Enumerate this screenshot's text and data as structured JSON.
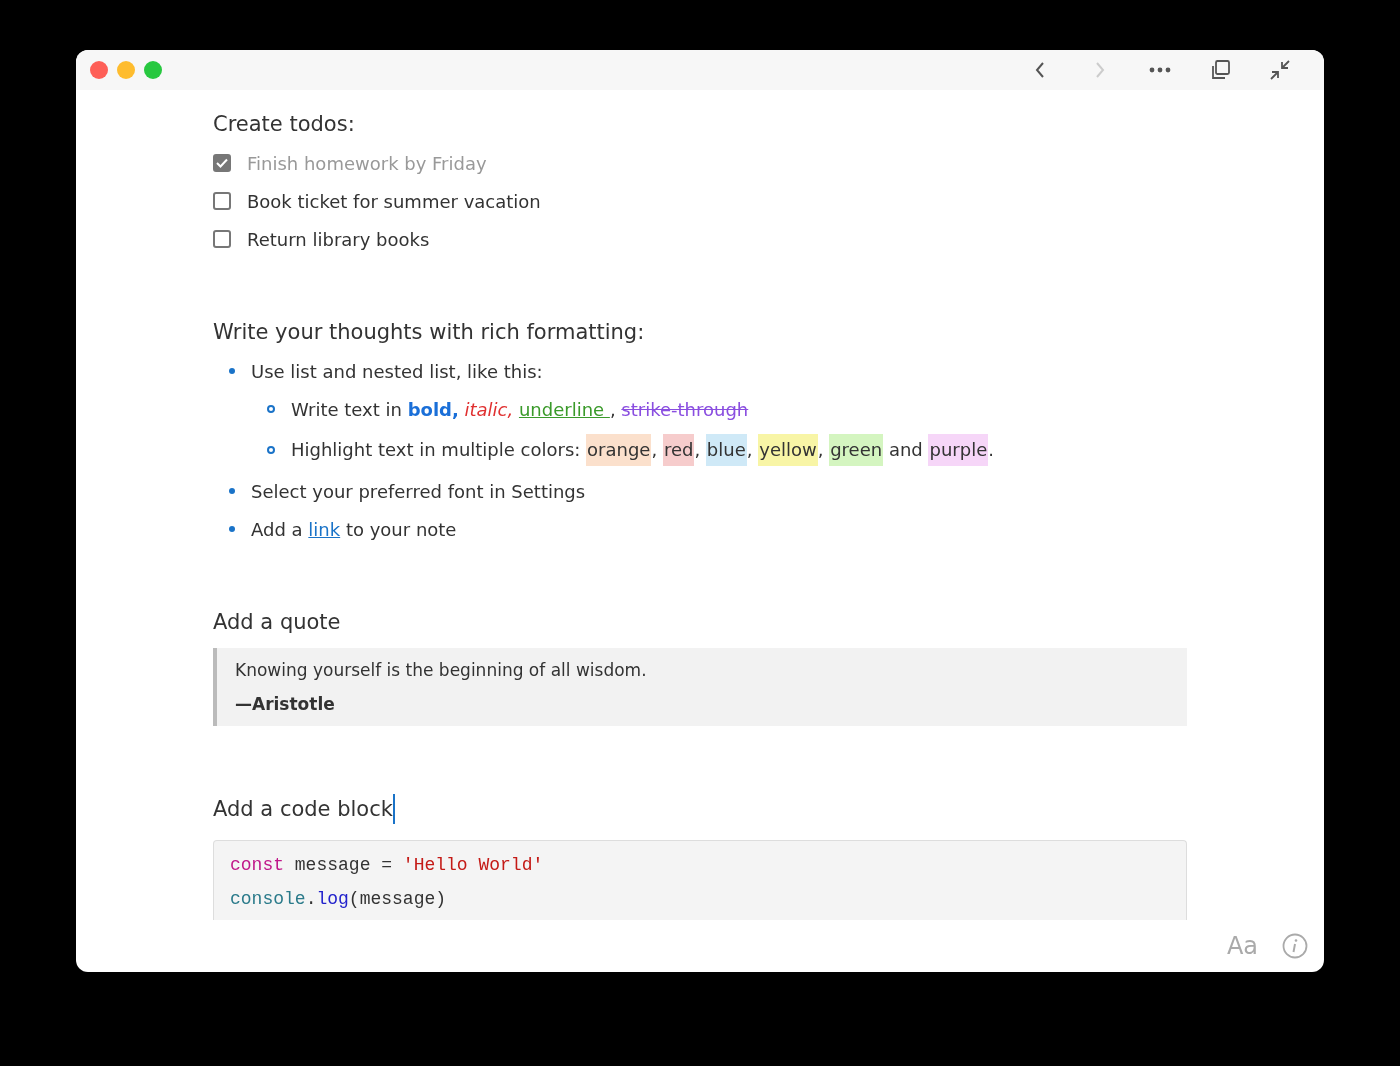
{
  "toolbar": {
    "back": {
      "disabled": false
    },
    "forward": {
      "disabled": true
    }
  },
  "sections": [
    {
      "kind": "todos",
      "heading": "Create todos:",
      "items": [
        {
          "text": "Finish homework by Friday",
          "checked": true
        },
        {
          "text": "Book ticket for summer vacation",
          "checked": false
        },
        {
          "text": "Return library books",
          "checked": false
        }
      ]
    },
    {
      "kind": "list",
      "heading": "Write your thoughts with rich formatting:",
      "items": [
        {
          "segments": [
            {
              "kind": "plain",
              "text": "Use list and nested list, like this:"
            }
          ],
          "children": [
            {
              "segments": [
                {
                  "kind": "plain",
                  "text": "Write text in "
                },
                {
                  "kind": "bold",
                  "text": "bold,"
                },
                {
                  "kind": "italic",
                  "text": " italic, "
                },
                {
                  "kind": "underline",
                  "text": "underline "
                },
                {
                  "kind": "plain",
                  "text": ", "
                },
                {
                  "kind": "strike",
                  "text": "strike-through"
                }
              ]
            },
            {
              "segments": [
                {
                  "kind": "plain",
                  "text": "Highlight text in multiple colors: "
                },
                {
                  "kind": "highlight",
                  "text": "orange",
                  "color": "#fbe0cc"
                },
                {
                  "kind": "plain",
                  "text": ", "
                },
                {
                  "kind": "highlight",
                  "text": "red",
                  "color": "#f6cccc"
                },
                {
                  "kind": "plain",
                  "text": ", "
                },
                {
                  "kind": "highlight",
                  "text": "blue",
                  "color": "#cfe9f7"
                },
                {
                  "kind": "plain",
                  "text": ", "
                },
                {
                  "kind": "highlight",
                  "text": "yellow",
                  "color": "#f8f5a6"
                },
                {
                  "kind": "plain",
                  "text": ", "
                },
                {
                  "kind": "highlight",
                  "text": "green",
                  "color": "#d4f5c0"
                },
                {
                  "kind": "plain",
                  "text": " and "
                },
                {
                  "kind": "highlight",
                  "text": "purple",
                  "color": "#f6d6f8"
                },
                {
                  "kind": "plain",
                  "text": "."
                }
              ]
            }
          ]
        },
        {
          "segments": [
            {
              "kind": "plain",
              "text": "Select your preferred font in Settings"
            }
          ]
        },
        {
          "segments": [
            {
              "kind": "plain",
              "text": "Add a "
            },
            {
              "kind": "link",
              "text": "link"
            },
            {
              "kind": "plain",
              "text": " to your note"
            }
          ]
        }
      ]
    },
    {
      "kind": "quote",
      "heading": "Add a quote",
      "quote": "Knowing yourself is the beginning of all wisdom.",
      "author": "—Aristotle"
    },
    {
      "kind": "code",
      "heading": "Add a code block",
      "cursor": true,
      "lines": [
        [
          {
            "kind": "keyword",
            "text": "const"
          },
          {
            "kind": "plain",
            "text": " message = "
          },
          {
            "kind": "string",
            "text": "'Hello World'"
          }
        ],
        [
          {
            "kind": "object",
            "text": "console"
          },
          {
            "kind": "plain",
            "text": "."
          },
          {
            "kind": "method",
            "text": "log"
          },
          {
            "kind": "plain",
            "text": "(message)"
          }
        ]
      ]
    }
  ],
  "footer": {
    "font_button": "Aa"
  }
}
